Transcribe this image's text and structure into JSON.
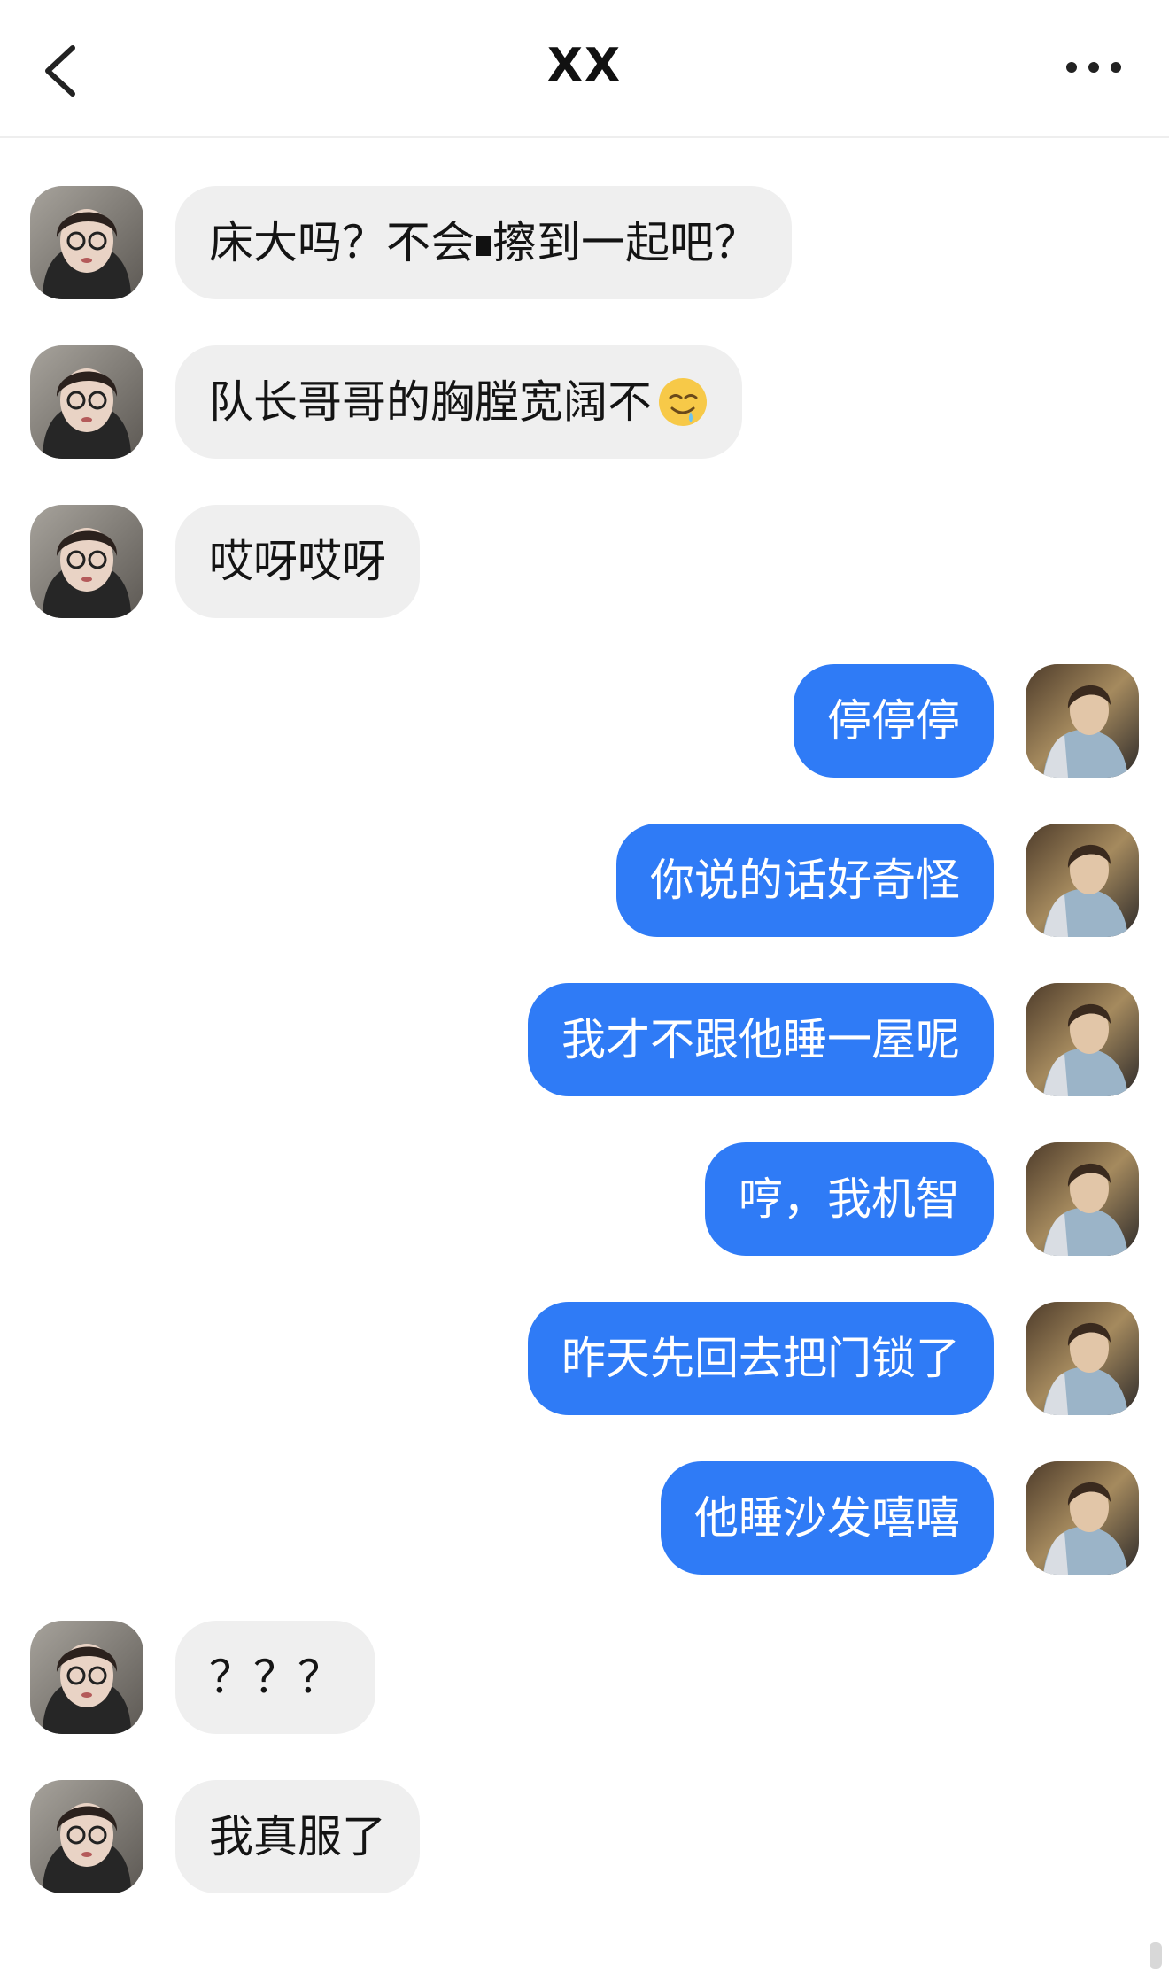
{
  "header": {
    "title": "XX",
    "back_icon": "chevron-left-icon",
    "more_icon": "more-dots-icon"
  },
  "colors": {
    "sent_bubble": "#2f7bf6",
    "received_bubble": "#efefef",
    "background": "#ffffff"
  },
  "messages": [
    {
      "side": "left",
      "text_before": "床大吗？不会",
      "text_after": "擦到一起吧？"
    },
    {
      "side": "left",
      "text_before": "队长哥哥的胸膛宽阔不",
      "text_after": ""
    },
    {
      "side": "left",
      "text": "哎呀哎呀"
    },
    {
      "side": "right",
      "text": "停停停"
    },
    {
      "side": "right",
      "text": "你说的话好奇怪"
    },
    {
      "side": "right",
      "text": "我才不跟他睡一屋呢"
    },
    {
      "side": "right",
      "text": "哼，我机智"
    },
    {
      "side": "right",
      "text": "昨天先回去把门锁了"
    },
    {
      "side": "right",
      "text": "他睡沙发嘻嘻"
    },
    {
      "side": "left",
      "text": "？？？"
    },
    {
      "side": "left",
      "text": "我真服了"
    }
  ],
  "emoji_icon": "drooling-face-icon"
}
